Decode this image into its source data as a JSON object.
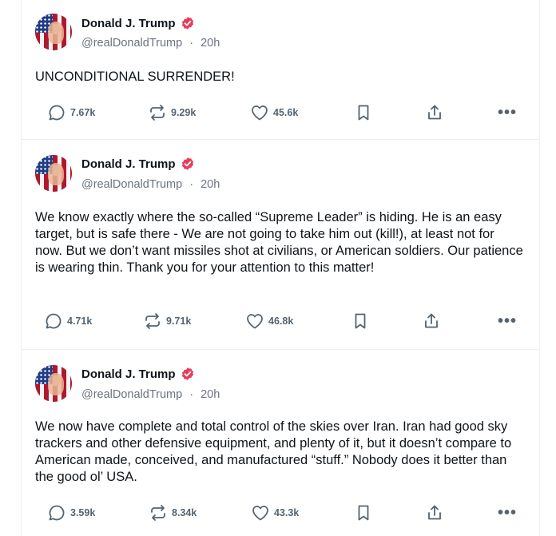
{
  "colors": {
    "verified": "#e63d5c",
    "text": "#0f1419",
    "muted": "#6b7280",
    "icon": "#536471"
  },
  "posts": [
    {
      "author": "Donald J. Trump",
      "handle": "@realDonaldTrump",
      "separator": "·",
      "time": "20h",
      "text": "UNCONDITIONAL SURRENDER!",
      "replies": "7.67k",
      "reposts": "9.29k",
      "likes": "45.6k"
    },
    {
      "author": "Donald J. Trump",
      "handle": "@realDonaldTrump",
      "separator": "·",
      "time": "20h",
      "text": "We know exactly where the so-called “Supreme Leader” is hiding. He is an easy target, but is safe there - We are not going to take him out (kill!), at least not for now. But we don’t want missiles shot at civilians, or American soldiers. Our patience is wearing thin. Thank you for your attention to this matter!",
      "replies": "4.71k",
      "reposts": "9.71k",
      "likes": "46.8k"
    },
    {
      "author": "Donald J. Trump",
      "handle": "@realDonaldTrump",
      "separator": "·",
      "time": "20h",
      "text": "We now have complete and total control of the skies over Iran. Iran had good sky trackers and other defensive equipment, and plenty of it, but it doesn’t compare to American made, conceived, and manufactured “stuff.” Nobody does it better than the good ol’ USA.",
      "replies": "3.59k",
      "reposts": "8.34k",
      "likes": "43.3k"
    }
  ],
  "icons": {
    "reply": "speech-bubble-icon",
    "repost": "repost-arrows-icon",
    "like": "heart-icon",
    "bookmark": "bookmark-icon",
    "share": "share-icon",
    "more": "ellipsis-icon",
    "verified": "verified-badge-icon"
  },
  "more_label": "•••"
}
